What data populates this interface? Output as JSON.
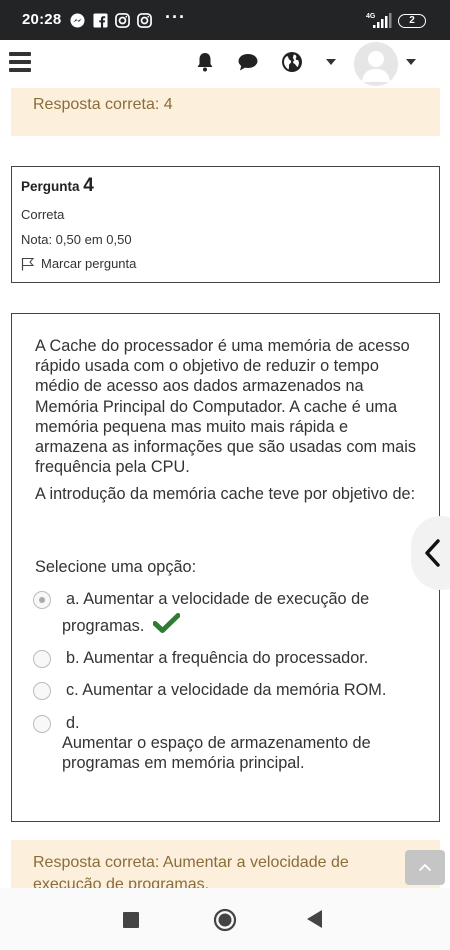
{
  "status_bar": {
    "time": "20:28",
    "dots": "···",
    "network": "4G",
    "battery": "2"
  },
  "app_bar": {
    "icons": [
      "menu-icon",
      "bell-icon",
      "chat-icon",
      "globe-icon",
      "avatar"
    ]
  },
  "top_feedback": {
    "text": "Resposta correta: 4"
  },
  "question_info": {
    "label": "Pergunta",
    "number": "4",
    "state": "Correta",
    "grade": "Nota: 0,50 em 0,50",
    "flag_label": "Marcar pergunta"
  },
  "question": {
    "paragraph1": "A Cache do processador é uma memória de acesso rápido usada com o objetivo de reduzir o tempo médio de acesso aos dados armazenados na Memória Principal do Computador. A cache é uma memória pequena mas muito mais rápida e armazena as informações que são usadas com mais frequência pela CPU.",
    "paragraph2": "A introdução da memória cache teve por objetivo de:",
    "prompt": "Selecione uma opção:",
    "options": [
      {
        "line1": "a. Aumentar a velocidade de execução de",
        "line2": "programas.",
        "selected": true,
        "correct": true
      },
      {
        "text": "b. Aumentar a frequência do processador.",
        "selected": false
      },
      {
        "text": "c. Aumentar a velocidade da memória ROM.",
        "selected": false
      },
      {
        "line1": "d.",
        "line2": "Aumentar o espaço de armazenamento de programas em memória principal.",
        "selected": false
      }
    ]
  },
  "bottom_feedback": {
    "text": "Resposta correta: Aumentar a velocidade de execução de programas."
  },
  "colors": {
    "feedback_bg": "#fcefdc",
    "feedback_text": "#8a6d3b",
    "correct_check": "#2e7d32",
    "status_bar_bg": "#222426"
  }
}
